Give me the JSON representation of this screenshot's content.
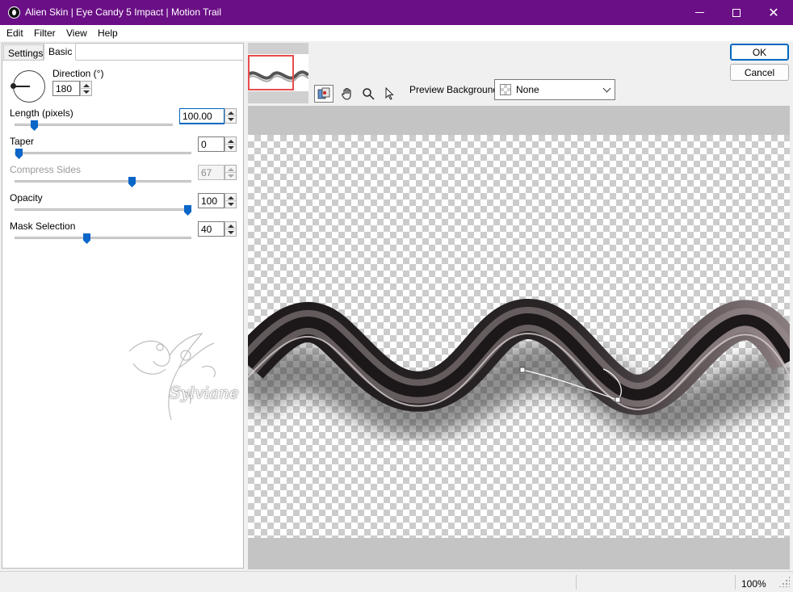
{
  "window": {
    "title": "Alien Skin | Eye Candy 5 Impact | Motion Trail",
    "app_icon": "alien-skin-icon",
    "controls": [
      "minimize-icon",
      "maximize-icon",
      "close-icon"
    ]
  },
  "menu": {
    "edit": "Edit",
    "filter": "Filter",
    "view": "View",
    "help": "Help"
  },
  "tabs": {
    "settings": "Settings",
    "basic": "Basic",
    "active": "Basic"
  },
  "controls": {
    "direction": {
      "label": "Direction (°)",
      "value": "180",
      "icon": "direction-dial-icon"
    },
    "length": {
      "label": "Length (pixels)",
      "value": "100.00",
      "slider_fraction": 0.1
    },
    "taper": {
      "label": "Taper",
      "value": "0",
      "slider_fraction": 0.0
    },
    "compress_sides": {
      "label": "Compress Sides",
      "value": "67",
      "disabled": true,
      "slider_fraction": 0.67
    },
    "opacity": {
      "label": "Opacity",
      "value": "100",
      "slider_fraction": 1.0
    },
    "mask_selection": {
      "label": "Mask Selection",
      "value": "40",
      "slider_fraction": 0.4
    }
  },
  "toolbar": {
    "tools": [
      "before-after-icon",
      "hand-pan-icon",
      "zoom-magnifier-icon",
      "arrow-select-icon"
    ],
    "active_tool": "before-after-icon",
    "preview_background_label": "Preview Background:",
    "preview_background_value": "None"
  },
  "buttons": {
    "ok": "OK",
    "cancel": "Cancel"
  },
  "watermark": {
    "text": "Sylviane"
  },
  "status": {
    "zoom": "100%"
  },
  "colors": {
    "titlebar": "#6b0f86",
    "accent": "#0067c0",
    "thumbnail_selection": "#e74c4c"
  }
}
